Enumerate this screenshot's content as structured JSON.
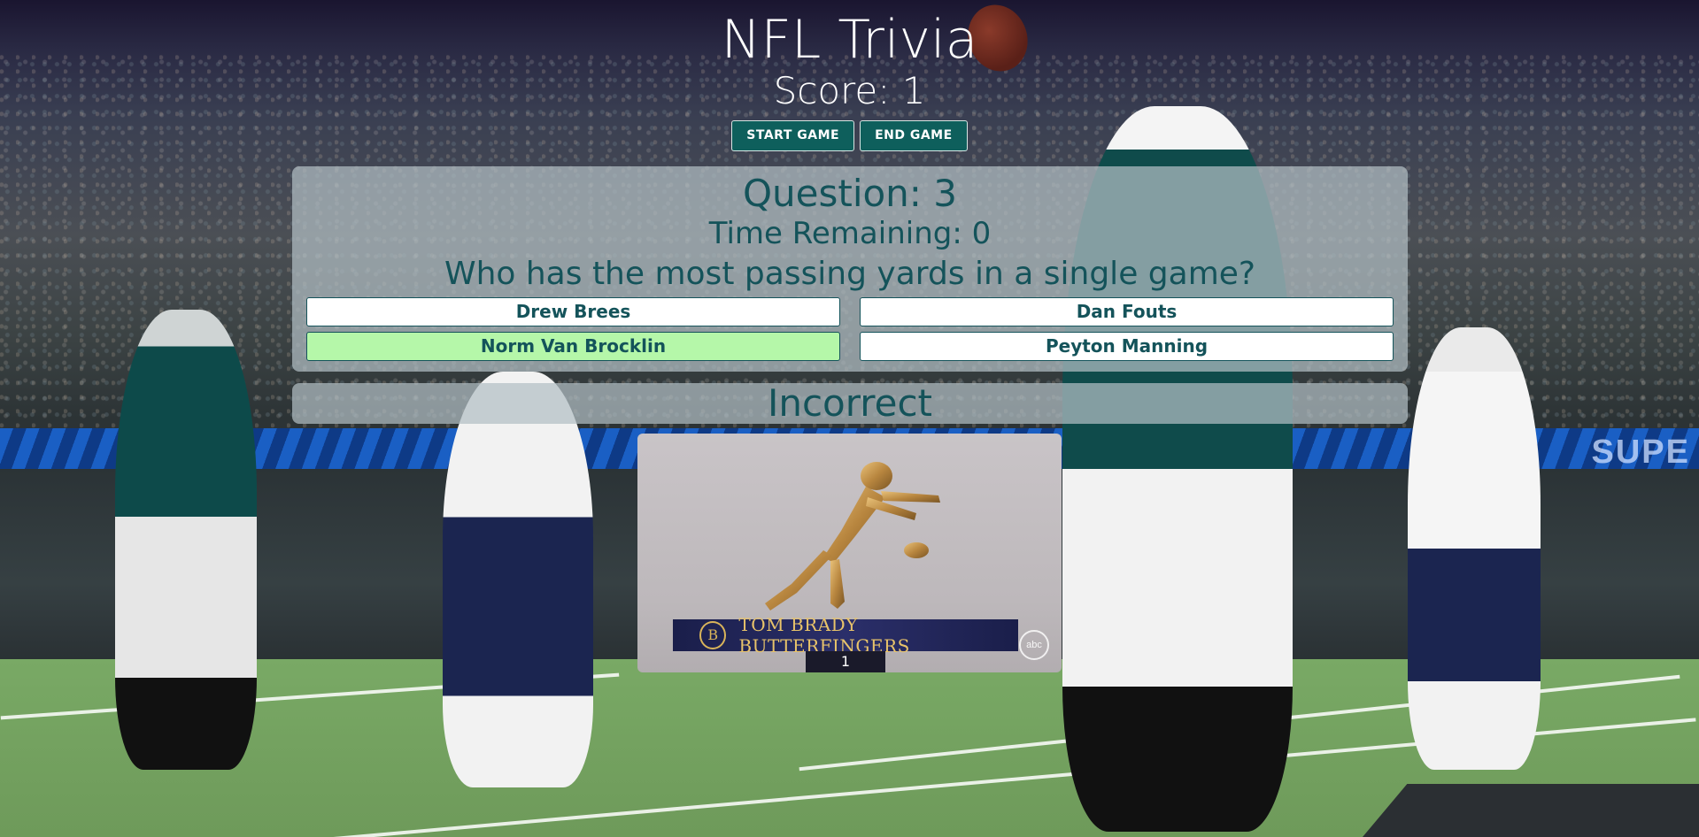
{
  "header": {
    "title": "NFL Trivia",
    "score_text": "Score: 1"
  },
  "controls": {
    "start_label": "START GAME",
    "end_label": "END GAME"
  },
  "question_panel": {
    "question_number_text": "Question: 3",
    "time_remaining_text": "Time Remaining: 0",
    "question_text": "Who has the most passing yards in a single game?",
    "answers": [
      {
        "label": "Drew Brees",
        "highlighted": false
      },
      {
        "label": "Dan Fouts",
        "highlighted": false
      },
      {
        "label": "Norm Van Brocklin",
        "highlighted": true
      },
      {
        "label": "Peyton Manning",
        "highlighted": false
      }
    ]
  },
  "result_panel": {
    "result_text": "Incorrect"
  },
  "gif": {
    "banner_text": "TOM BRADY BUTTERFINGERS",
    "logo_letter": "B",
    "network_badge": "abc",
    "pedestal_number": "1"
  },
  "colors": {
    "accent_teal": "#14535a",
    "button_bg": "#0e5f5c",
    "correct_answer_bg": "#b5f7a9",
    "panel_bg": "rgba(178,190,196,0.72)"
  },
  "background_ribbon_text": "SUPE"
}
